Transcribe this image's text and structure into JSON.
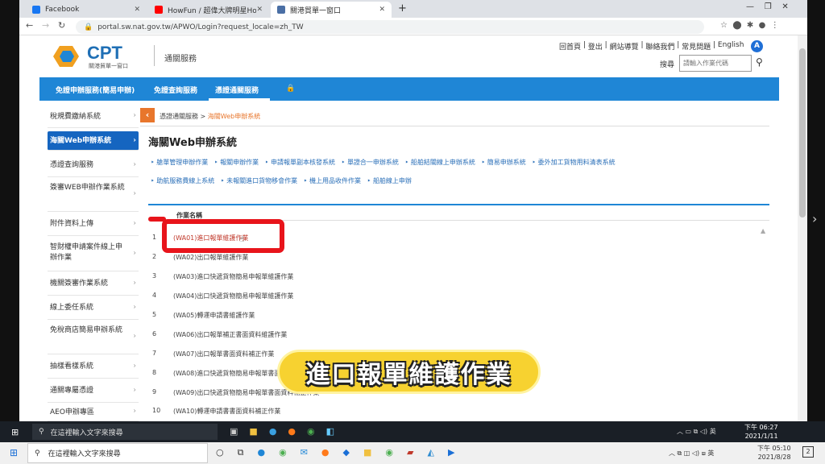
{
  "tabs": [
    {
      "label": "Facebook",
      "color": "#1877f2"
    },
    {
      "label": "HowFun / 超偉大牌明星How哥",
      "color": "#ff0000"
    },
    {
      "label": "關港貿單一窗口",
      "color": "#4a6fa5"
    }
  ],
  "address": {
    "url": "portal.sw.nat.gov.tw/APWO/Login?request_locale=zh_TW"
  },
  "logo": {
    "brand": "CPT",
    "sub": "關港貿單一窗口",
    "service": "通關服務"
  },
  "toplinks": [
    "回首頁",
    "登出",
    "網站導覽",
    "聯絡我們",
    "常見問題",
    "English"
  ],
  "search": {
    "label": "搜尋",
    "placeholder": "請輸入作業代碼"
  },
  "nav": [
    "免證申辦服務(簡易申辦)",
    "免證查詢服務",
    "憑證通關服務"
  ],
  "sidebar": [
    "稅規費繳納系統",
    "海關Web申辦系統",
    "憑證查詢服務",
    "簽審WEB申辦作業系統",
    "附件資料上傳",
    "智財權申請案件線上申辦作業",
    "機關簽審作業系統",
    "線上委任系統",
    "免稅商店簡易申辦系統",
    "抽樣看樣系統",
    "通關專屬憑證",
    "AEO申辦專區"
  ],
  "breadcrumb": {
    "parent": "憑證通關服務",
    "sep": ">",
    "current": "海關Web申辦系統"
  },
  "heading": "海關Web申辦系統",
  "sublinks1": [
    "艙單管理申辦作業",
    "報關申辦作業",
    "申請報單副本核發系統",
    "單證合一申辦系統",
    "船舶結關線上申辦系統",
    "簡易申辦系統",
    "委外加工貨物用料清表系統"
  ],
  "sublinks2": [
    "助航服務費線上系統",
    "未報關進口貨物移會作業",
    "機上用品收件作業",
    "船舶線上申辦"
  ],
  "table": {
    "header": "作業名稱",
    "rows": [
      {
        "n": "1",
        "t": "(WA01)進口報單維護作業"
      },
      {
        "n": "2",
        "t": "(WA02)出口報單維護作業"
      },
      {
        "n": "3",
        "t": "(WA03)進口快遞貨物簡易申報單維護作業"
      },
      {
        "n": "4",
        "t": "(WA04)出口快遞貨物簡易申報單維護作業"
      },
      {
        "n": "5",
        "t": "(WA05)轉運申請書維護作業"
      },
      {
        "n": "6",
        "t": "(WA06)出口報單補正書面資料維護作業"
      },
      {
        "n": "7",
        "t": "(WA07)出口報單書面資料補正作業"
      },
      {
        "n": "8",
        "t": "(WA08)進口快遞貨物簡易申報單書面資料補正作業"
      },
      {
        "n": "9",
        "t": "(WA09)出口快遞貨物簡易申報單書面資料補正作業"
      },
      {
        "n": "10",
        "t": "(WA10)轉運申請書書面資料補正作業"
      }
    ]
  },
  "caption": "進口報單維護作業",
  "taskbar": {
    "search_placeholder": "在這裡輸入文字來搜尋",
    "time1": "下午 06:27",
    "date1": "2021/1/11",
    "time2": "下午 05:10",
    "date2": "2021/8/28",
    "ime": "英",
    "notif": "2"
  },
  "colors": {
    "blue": "#1f86d6",
    "orange": "#e8762c",
    "red": "#e8141b",
    "caption_yellow": "#f7d230"
  }
}
